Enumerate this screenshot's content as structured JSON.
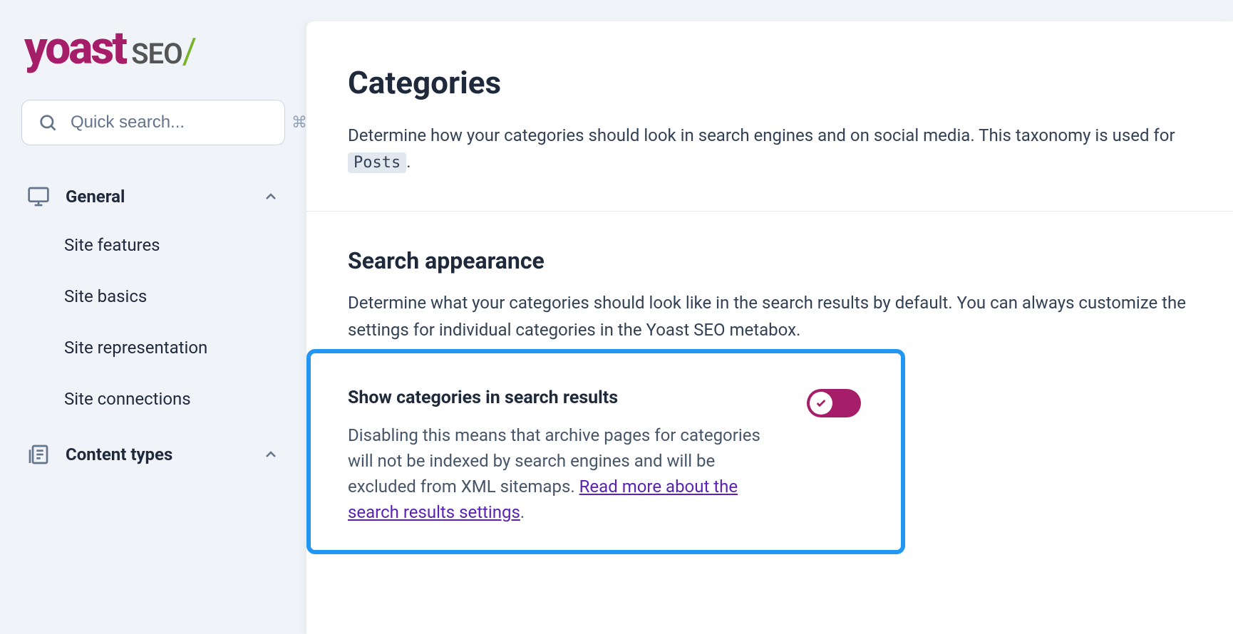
{
  "logo": {
    "brand": "yoast",
    "product": "SEO",
    "slash": "/"
  },
  "search": {
    "placeholder": "Quick search...",
    "shortcut": "⌘K"
  },
  "sidebar": {
    "sections": [
      {
        "label": "General",
        "expanded": true,
        "items": [
          {
            "label": "Site features"
          },
          {
            "label": "Site basics"
          },
          {
            "label": "Site representation"
          },
          {
            "label": "Site connections"
          }
        ]
      },
      {
        "label": "Content types",
        "expanded": true
      }
    ]
  },
  "page": {
    "title": "Categories",
    "description_pre": "Determine how your categories should look in search engines and on social media. This taxonomy is used for ",
    "description_code": "Posts",
    "description_post": "."
  },
  "search_appearance": {
    "title": "Search appearance",
    "description": "Determine what your categories should look like in the search results by default. You can always customize the settings for individual categories in the Yoast SEO metabox.",
    "toggle": {
      "label": "Show categories in search results",
      "description": "Disabling this means that archive pages for categories will not be indexed by search engines and will be excluded from XML sitemaps. ",
      "link_text": "Read more about the search results settings",
      "description_post": ".",
      "enabled": true
    }
  }
}
